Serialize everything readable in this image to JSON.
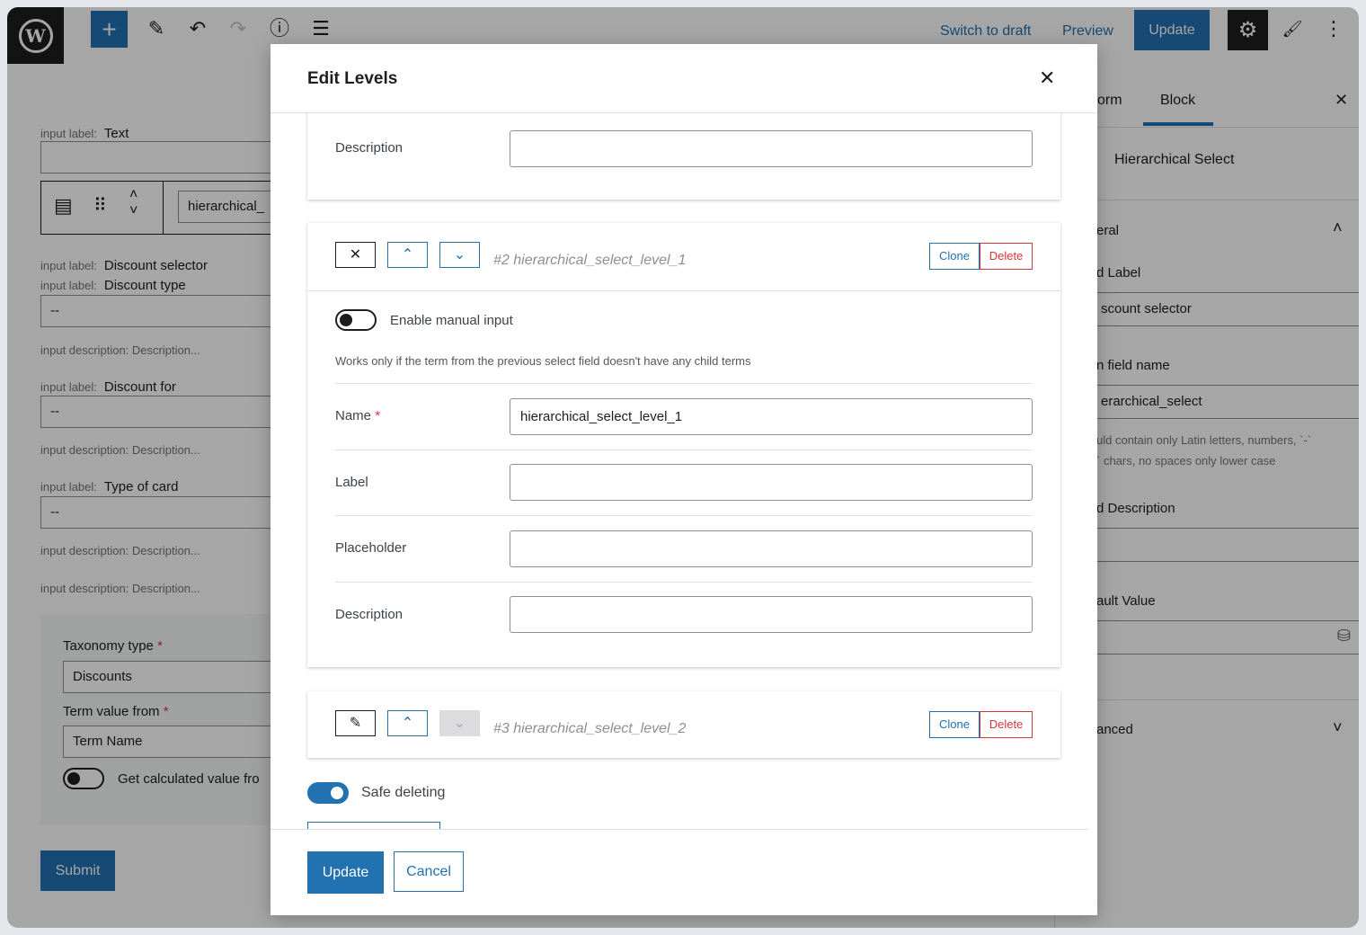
{
  "toolbar": {
    "wp_logo": "W",
    "add_icon": "+",
    "edit_icon": "✎",
    "undo_icon": "↶",
    "redo_icon": "↷",
    "info_icon": "ⓘ",
    "list_view_icon": "☰",
    "switch_to_draft": "Switch to draft",
    "preview": "Preview",
    "update": "Update",
    "settings_icon": "⚙",
    "style_icon": "🖌",
    "more_icon": "⋮"
  },
  "canvas": {
    "input_label_prefix": "input label:",
    "input_description_prefix": "input description:",
    "description_placeholder": "Description...",
    "text_label": "Text",
    "block_field_value": "hierarchical_",
    "discount_selector": "Discount selector",
    "discount_type": "Discount type",
    "discount_for": "Discount for",
    "type_of_card": "Type of card",
    "empty_value": "--",
    "taxonomy_type_label": "Taxonomy type",
    "taxonomy_type_value": "Discounts",
    "term_value_from_label": "Term value from",
    "term_value_from_value": "Term Name",
    "get_calculated_value": "Get calculated value fro",
    "required_mark": "*",
    "submit": "Submit"
  },
  "sidebar": {
    "tab_form": "orm",
    "tab_block": "Block",
    "close_icon": "✕",
    "block_name": "Hierarchical Select",
    "general_section": "eral",
    "field_label": "d Label",
    "field_label_value": "scount selector",
    "form_field_name": "n field name",
    "form_field_name_value": "erarchical_select",
    "field_name_help_1": "uld contain only Latin letters, numbers, `-`",
    "field_name_help_2": "` chars, no spaces only lower case",
    "field_description": "d Description",
    "default_value": "ault Value",
    "advanced_section": "anced"
  },
  "modal": {
    "title": "Edit Levels",
    "close_icon": "✕",
    "level1": {
      "description_label": "Description",
      "description_value": ""
    },
    "level2": {
      "title": "#2 hierarchical_select_level_1",
      "collapse_icon": "✕",
      "up_icon": "⌃",
      "down_icon": "⌄",
      "clone": "Clone",
      "delete": "Delete",
      "manual_input_label": "Enable manual input",
      "manual_input_help": "Works only if the term from the previous select field doesn't have any child terms",
      "name_label": "Name",
      "required_mark": "*",
      "name_value": "hierarchical_select_level_1",
      "label_label": "Label",
      "label_value": "",
      "placeholder_label": "Placeholder",
      "placeholder_value": "",
      "description_label": "Description",
      "description_value": ""
    },
    "level3": {
      "title": "#3 hierarchical_select_level_2",
      "edit_icon": "✎",
      "up_icon": "⌃",
      "down_icon": "⌄",
      "clone": "Clone",
      "delete": "Delete"
    },
    "safe_deleting": "Safe deleting",
    "update": "Update",
    "cancel": "Cancel"
  },
  "colors": {
    "accent": "#2271b1",
    "danger": "#d63638",
    "dark": "#1e1e1e"
  }
}
